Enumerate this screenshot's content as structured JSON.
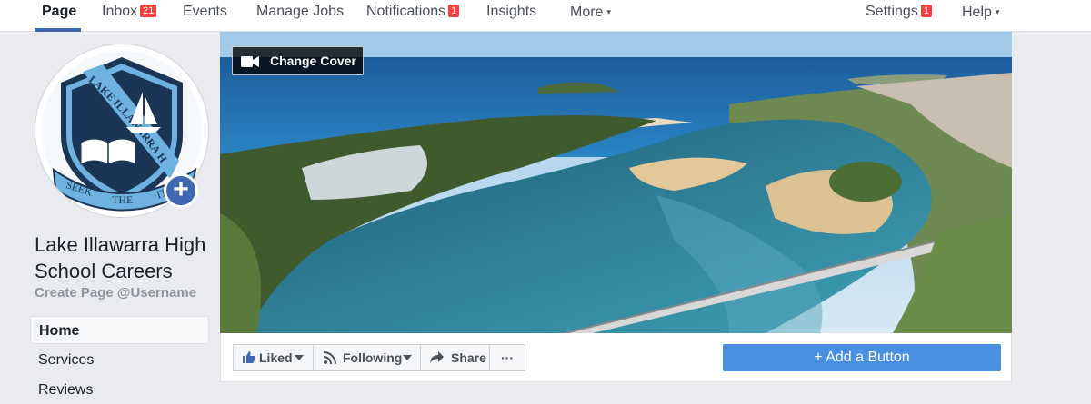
{
  "topnav": {
    "page": "Page",
    "inbox": "Inbox",
    "inbox_count": "21",
    "events": "Events",
    "manage_jobs": "Manage Jobs",
    "notifications": "Notifications",
    "notifications_count": "1",
    "insights": "Insights",
    "more": "More",
    "settings": "Settings",
    "settings_count": "1",
    "help": "Help",
    "caret_glyph": "▾"
  },
  "logo": {
    "school_name": "LAKE ILLAWARRA HIGH SCHOOL",
    "motto_left": "SEEK",
    "motto_mid": "THE",
    "motto_right": "TRUTH",
    "colors": {
      "navy": "#1b3556",
      "light_blue": "#6fb2e0"
    }
  },
  "profile": {
    "add_photo_glyph": "+",
    "name": "Lake Illawarra High School Careers",
    "username_link": "Create Page @Username"
  },
  "sidebar": {
    "items": [
      {
        "label": "Home"
      },
      {
        "label": "Services"
      },
      {
        "label": "Reviews"
      }
    ]
  },
  "cover": {
    "change_cover": "Change Cover"
  },
  "actions": {
    "liked": "Liked",
    "following": "Following",
    "share": "Share",
    "more_glyph": "···",
    "add_button": "+ Add a Button"
  },
  "colors": {
    "facebook_blue": "#4267b2",
    "badge_red": "#fa3e3e",
    "cta_blue": "#4a90e2"
  }
}
